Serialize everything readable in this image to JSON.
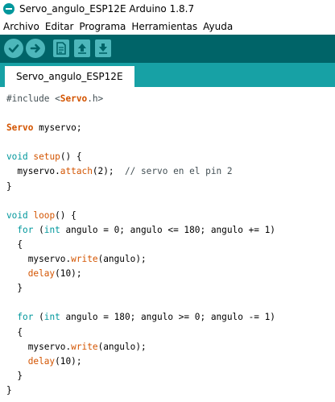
{
  "window": {
    "title": "Servo_angulo_ESP12E Arduino 1.8.7",
    "icon": "arduino-logo-icon"
  },
  "menu": [
    "Archivo",
    "Editar",
    "Programa",
    "Herramientas",
    "Ayuda"
  ],
  "toolbar": {
    "buttons": [
      "verify-icon",
      "upload-icon",
      "new-sketch-icon",
      "open-icon",
      "save-icon"
    ]
  },
  "tabs": [
    {
      "label": "Servo_angulo_ESP12E",
      "active": true
    }
  ],
  "colors": {
    "toolbar_bg": "#006468",
    "tabstrip_bg": "#17a1a5",
    "button_bg": "#4db7bb",
    "keyword": "#00979c",
    "type_orange": "#d35400",
    "comment": "#434f54"
  },
  "code": [
    [
      {
        "t": "#include <",
        "c": "t-grey"
      },
      {
        "t": "Servo",
        "c": "t-orange t-bold"
      },
      {
        "t": ".h>",
        "c": "t-grey"
      }
    ],
    [],
    [
      {
        "t": "Servo",
        "c": "t-orange t-bold"
      },
      {
        "t": " myservo;",
        "c": "t-default"
      }
    ],
    [],
    [
      {
        "t": "void",
        "c": "t-teal"
      },
      {
        "t": " ",
        "c": "t-default"
      },
      {
        "t": "setup",
        "c": "t-orange"
      },
      {
        "t": "() {",
        "c": "t-default"
      }
    ],
    [
      {
        "t": "  myservo.",
        "c": "t-default"
      },
      {
        "t": "attach",
        "c": "t-orange"
      },
      {
        "t": "(2);  ",
        "c": "t-default"
      },
      {
        "t": "// servo en el pin 2",
        "c": "t-grey"
      }
    ],
    [
      {
        "t": "}",
        "c": "t-default"
      }
    ],
    [],
    [
      {
        "t": "void",
        "c": "t-teal"
      },
      {
        "t": " ",
        "c": "t-default"
      },
      {
        "t": "loop",
        "c": "t-orange"
      },
      {
        "t": "() {",
        "c": "t-default"
      }
    ],
    [
      {
        "t": "  ",
        "c": "t-default"
      },
      {
        "t": "for",
        "c": "t-teal"
      },
      {
        "t": " (",
        "c": "t-default"
      },
      {
        "t": "int",
        "c": "t-teal"
      },
      {
        "t": " angulo = 0; angulo <= 180; angulo += 1)",
        "c": "t-default"
      }
    ],
    [
      {
        "t": "  {",
        "c": "t-default"
      }
    ],
    [
      {
        "t": "    myservo.",
        "c": "t-default"
      },
      {
        "t": "write",
        "c": "t-orange"
      },
      {
        "t": "(angulo);",
        "c": "t-default"
      }
    ],
    [
      {
        "t": "    ",
        "c": "t-default"
      },
      {
        "t": "delay",
        "c": "t-orange"
      },
      {
        "t": "(10);",
        "c": "t-default"
      }
    ],
    [
      {
        "t": "  }",
        "c": "t-default"
      }
    ],
    [],
    [
      {
        "t": "  ",
        "c": "t-default"
      },
      {
        "t": "for",
        "c": "t-teal"
      },
      {
        "t": " (",
        "c": "t-default"
      },
      {
        "t": "int",
        "c": "t-teal"
      },
      {
        "t": " angulo = 180; angulo >= 0; angulo -= 1)",
        "c": "t-default"
      }
    ],
    [
      {
        "t": "  {",
        "c": "t-default"
      }
    ],
    [
      {
        "t": "    myservo.",
        "c": "t-default"
      },
      {
        "t": "write",
        "c": "t-orange"
      },
      {
        "t": "(angulo);",
        "c": "t-default"
      }
    ],
    [
      {
        "t": "    ",
        "c": "t-default"
      },
      {
        "t": "delay",
        "c": "t-orange"
      },
      {
        "t": "(10);",
        "c": "t-default"
      }
    ],
    [
      {
        "t": "  }",
        "c": "t-default"
      }
    ],
    [
      {
        "t": "}",
        "c": "t-default"
      }
    ]
  ]
}
